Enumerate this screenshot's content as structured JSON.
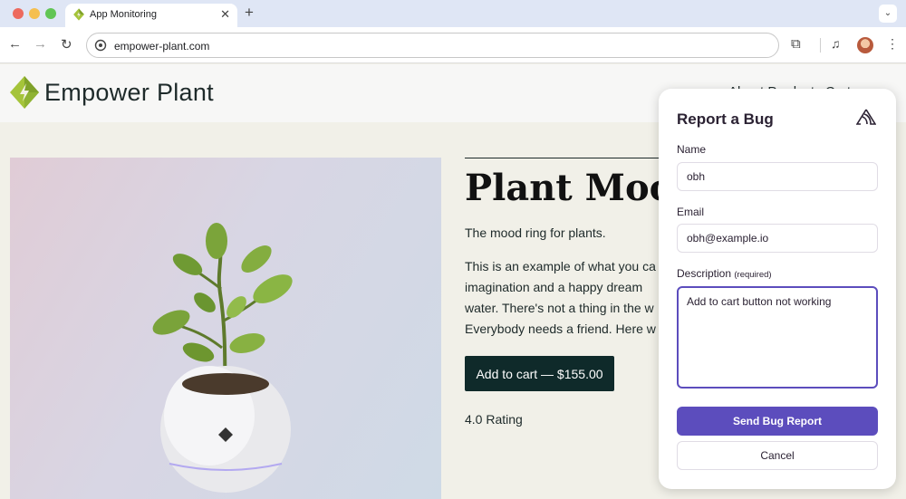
{
  "browser": {
    "tab_title": "App Monitoring",
    "url": "empower-plant.com",
    "icons": {
      "back": "arrow-left-icon",
      "forward": "arrow-right-icon",
      "reload": "reload-icon",
      "site_info": "site-info-icon",
      "extensions": "puzzle-icon",
      "media": "media-control-icon",
      "menu": "kebab-menu-icon"
    }
  },
  "site": {
    "brand": "Empower Plant",
    "nav_visible": "About  Products  Cart"
  },
  "product": {
    "title": "Plant Mood",
    "tagline": "The mood ring for plants.",
    "description_lines": [
      "This is an example of what you ca",
      "imagination and a happy dream",
      "water. There's not a thing in the w",
      "Everybody needs a friend. Here w"
    ],
    "cart_label": "Add to cart — $155.00",
    "rating": "4.0 Rating"
  },
  "bug_report": {
    "title": "Report a Bug",
    "name_label": "Name",
    "name_value": "obh",
    "email_label": "Email",
    "email_value": "obh@example.io",
    "description_label": "Description",
    "description_required": "(required)",
    "description_value": "Add to cart button not working",
    "submit_label": "Send Bug Report",
    "cancel_label": "Cancel"
  },
  "colors": {
    "accent": "#5c4dbd",
    "cart_button": "#0f2a2a",
    "page_background": "#f1f0e8"
  }
}
